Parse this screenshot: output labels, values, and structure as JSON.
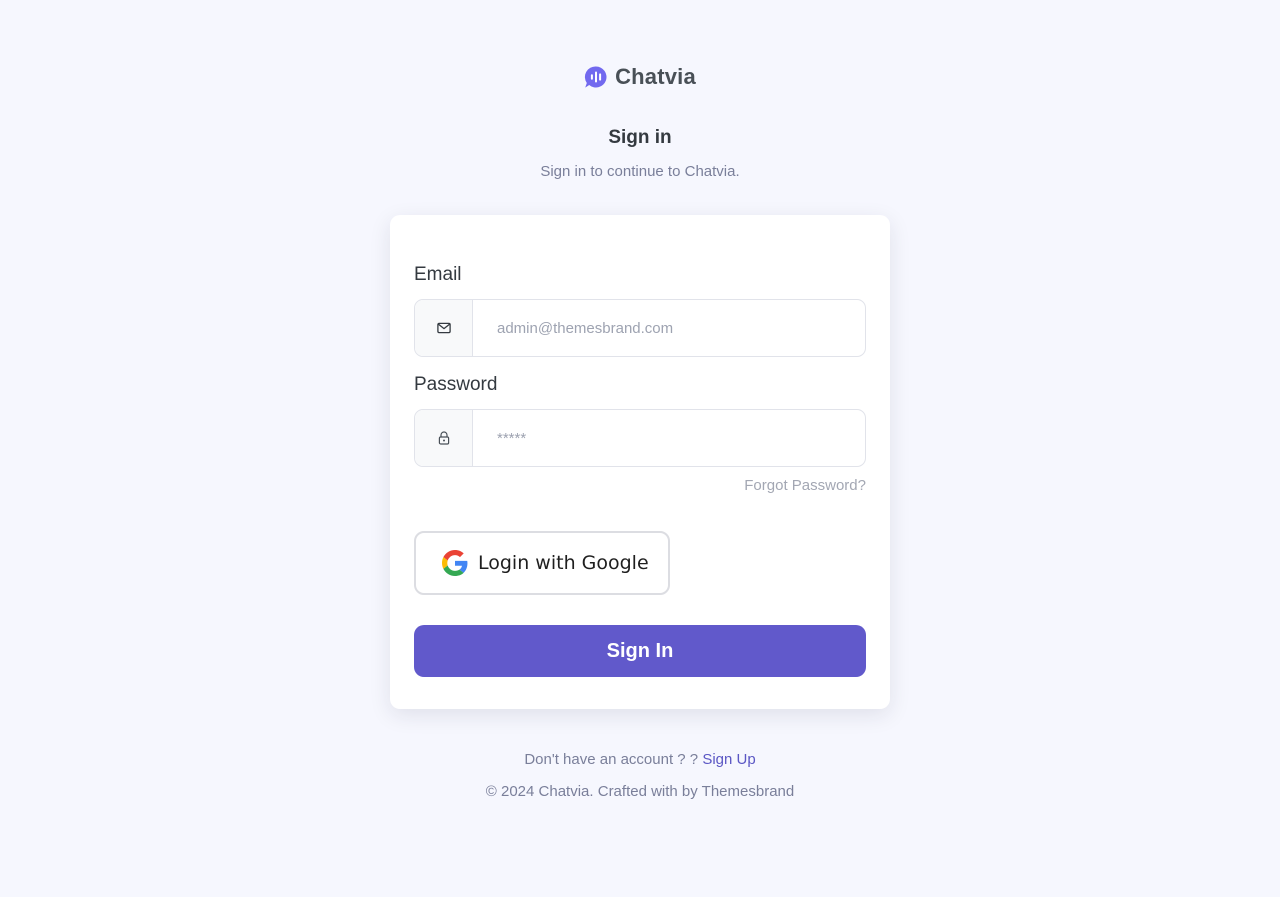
{
  "brand": {
    "name": "Chatvia",
    "icon": "chat-bubble-icon",
    "accent_color": "#7269ef"
  },
  "header": {
    "title": "Sign in",
    "subtitle": "Sign in to continue to Chatvia."
  },
  "form": {
    "email": {
      "label": "Email",
      "placeholder": "admin@themesbrand.com",
      "value": "",
      "icon": "mail-icon"
    },
    "password": {
      "label": "Password",
      "placeholder": "*****",
      "value": "",
      "icon": "lock-icon"
    },
    "forgot_label": "Forgot Password?",
    "google_label": "Login with Google",
    "submit_label": "Sign In",
    "submit_color": "#6159cb"
  },
  "footer": {
    "account_prompt": "Don't have an account ? ?",
    "signup_label": "Sign Up",
    "copyright": "© 2024 Chatvia. Crafted with by Themesbrand"
  }
}
